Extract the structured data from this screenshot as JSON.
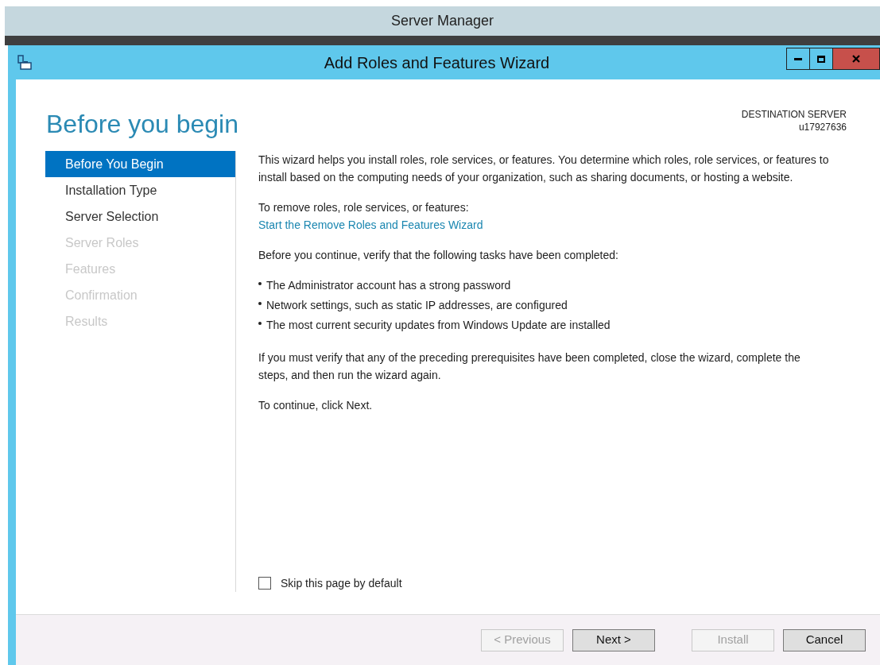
{
  "background_window": {
    "title": "Server Manager"
  },
  "window": {
    "title": "Add Roles and Features Wizard"
  },
  "page_title": "Before you begin",
  "destination": {
    "label": "DESTINATION SERVER",
    "server": "u17927636"
  },
  "steps": [
    {
      "label": "Before You Begin",
      "selected": true,
      "disabled": false
    },
    {
      "label": "Installation Type",
      "selected": false,
      "disabled": false
    },
    {
      "label": "Server Selection",
      "selected": false,
      "disabled": false
    },
    {
      "label": "Server Roles",
      "selected": false,
      "disabled": true
    },
    {
      "label": "Features",
      "selected": false,
      "disabled": true
    },
    {
      "label": "Confirmation",
      "selected": false,
      "disabled": true
    },
    {
      "label": "Results",
      "selected": false,
      "disabled": true
    }
  ],
  "content": [
    {
      "kind": "paragraph",
      "text": "This wizard helps you install roles, role services, or features. You determine which roles, role services, or features to install based on the computing needs of your organization, such as sharing documents, or hosting a website."
    },
    {
      "kind": "link_block",
      "text": "To remove roles, role services, or features:",
      "link": "Start the Remove Roles and Features Wizard"
    },
    {
      "kind": "paragraph",
      "text": "Before you continue, verify that the following tasks have been completed:"
    },
    {
      "kind": "bullets",
      "items": [
        "The Administrator account has a strong password",
        "Network settings, such as static IP addresses, are configured",
        "The most current security updates from Windows Update are installed"
      ]
    },
    {
      "kind": "paragraph",
      "text": "If you must verify that any of the preceding prerequisites have been completed, close the wizard, complete the steps, and then run the wizard again."
    },
    {
      "kind": "paragraph",
      "text": "To continue, click Next."
    }
  ],
  "skip_checkbox": {
    "label": "Skip this page by default",
    "checked": false
  },
  "buttons": [
    {
      "label": "< Previous",
      "disabled": true
    },
    {
      "label": "Next >",
      "disabled": false
    },
    {
      "label": "Install",
      "disabled": true
    },
    {
      "label": "Cancel",
      "disabled": false
    }
  ]
}
